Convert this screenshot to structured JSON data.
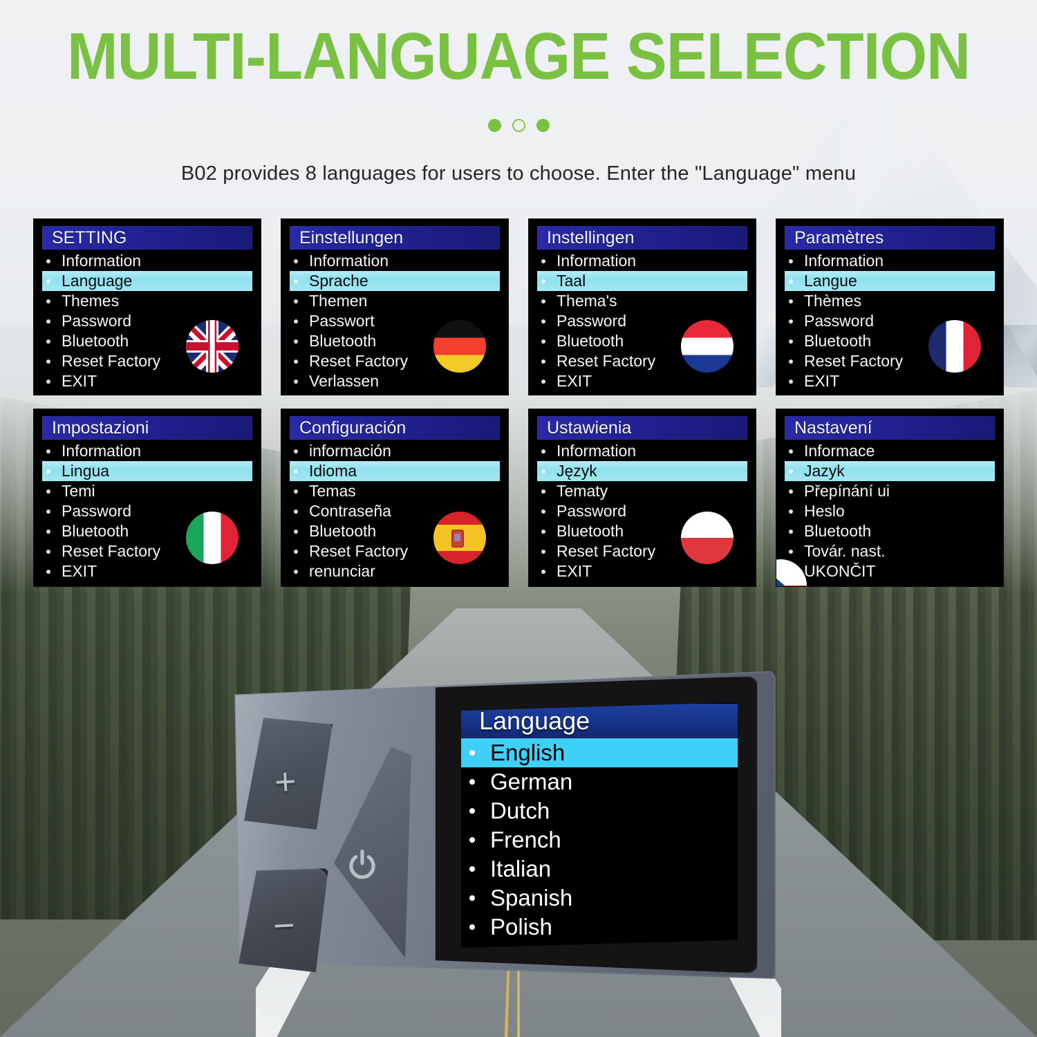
{
  "header": {
    "title": "MULTI-LANGUAGE SELECTION",
    "subtitle": "B02 provides 8 languages for users to choose. Enter the \"Language\" menu",
    "dots": [
      "filled",
      "hollow",
      "filled"
    ],
    "accent_color": "#7ac143"
  },
  "panels": [
    {
      "flag": "uk-flag-icon",
      "title": "SETTING",
      "items": [
        {
          "label": "Information",
          "selected": false
        },
        {
          "label": "Language",
          "selected": true
        },
        {
          "label": "Themes",
          "selected": false
        },
        {
          "label": "Password",
          "selected": false
        },
        {
          "label": "Bluetooth",
          "selected": false
        },
        {
          "label": "Reset Factory",
          "selected": false
        },
        {
          "label": "EXIT",
          "selected": false
        }
      ]
    },
    {
      "flag": "germany-flag-icon",
      "title": "Einstellungen",
      "items": [
        {
          "label": "Information",
          "selected": false
        },
        {
          "label": "Sprache",
          "selected": true
        },
        {
          "label": "Themen",
          "selected": false
        },
        {
          "label": "Passwort",
          "selected": false
        },
        {
          "label": "Bluetooth",
          "selected": false
        },
        {
          "label": "Reset Factory",
          "selected": false
        },
        {
          "label": "Verlassen",
          "selected": false
        }
      ]
    },
    {
      "flag": "netherlands-flag-icon",
      "title": "Instellingen",
      "items": [
        {
          "label": "Information",
          "selected": false
        },
        {
          "label": "Taal",
          "selected": true
        },
        {
          "label": "Thema's",
          "selected": false
        },
        {
          "label": "Password",
          "selected": false
        },
        {
          "label": "Bluetooth",
          "selected": false
        },
        {
          "label": "Reset Factory",
          "selected": false
        },
        {
          "label": "EXIT",
          "selected": false
        }
      ]
    },
    {
      "flag": "france-flag-icon",
      "title": "Paramètres",
      "items": [
        {
          "label": "Information",
          "selected": false
        },
        {
          "label": "Langue",
          "selected": true
        },
        {
          "label": "Thèmes",
          "selected": false
        },
        {
          "label": "Password",
          "selected": false
        },
        {
          "label": "Bluetooth",
          "selected": false
        },
        {
          "label": "Reset Factory",
          "selected": false
        },
        {
          "label": "EXIT",
          "selected": false
        }
      ]
    },
    {
      "flag": "italy-flag-icon",
      "title": "Impostazioni",
      "items": [
        {
          "label": "Information",
          "selected": false
        },
        {
          "label": "Lingua",
          "selected": true
        },
        {
          "label": "Temi",
          "selected": false
        },
        {
          "label": "Password",
          "selected": false
        },
        {
          "label": "Bluetooth",
          "selected": false
        },
        {
          "label": "Reset Factory",
          "selected": false
        },
        {
          "label": "EXIT",
          "selected": false
        }
      ]
    },
    {
      "flag": "spain-flag-icon",
      "title": "Configuración",
      "items": [
        {
          "label": "información",
          "selected": false
        },
        {
          "label": "Idioma",
          "selected": true
        },
        {
          "label": "Temas",
          "selected": false
        },
        {
          "label": "Contraseña",
          "selected": false
        },
        {
          "label": "Bluetooth",
          "selected": false
        },
        {
          "label": "Reset Factory",
          "selected": false
        },
        {
          "label": "renunciar",
          "selected": false
        }
      ]
    },
    {
      "flag": "poland-flag-icon",
      "title": "Ustawienia",
      "items": [
        {
          "label": "Information",
          "selected": false
        },
        {
          "label": "Język",
          "selected": true
        },
        {
          "label": "Tematy",
          "selected": false
        },
        {
          "label": "Password",
          "selected": false
        },
        {
          "label": "Bluetooth",
          "selected": false
        },
        {
          "label": "Reset Factory",
          "selected": false
        },
        {
          "label": "EXIT",
          "selected": false
        }
      ]
    },
    {
      "flag": "czech-flag-icon",
      "title": "Nastavení",
      "items": [
        {
          "label": "Informace",
          "selected": false
        },
        {
          "label": "Jazyk",
          "selected": true
        },
        {
          "label": "Přepínání ui",
          "selected": false
        },
        {
          "label": "Heslo",
          "selected": false
        },
        {
          "label": "Bluetooth",
          "selected": false
        },
        {
          "label": "Továr. nast.",
          "selected": false
        },
        {
          "label": "UKONČIT",
          "selected": false
        }
      ]
    }
  ],
  "device": {
    "buttons": [
      {
        "name": "plus-button",
        "glyph": "+"
      },
      {
        "name": "power-button",
        "glyph": "power-icon"
      },
      {
        "name": "minus-button",
        "glyph": "−"
      }
    ],
    "screen": {
      "title": "Language",
      "items": [
        {
          "label": "English",
          "selected": true
        },
        {
          "label": "German",
          "selected": false
        },
        {
          "label": "Dutch",
          "selected": false
        },
        {
          "label": "French",
          "selected": false
        },
        {
          "label": "Italian",
          "selected": false
        },
        {
          "label": "Spanish",
          "selected": false
        },
        {
          "label": "Polish",
          "selected": false
        }
      ]
    }
  }
}
